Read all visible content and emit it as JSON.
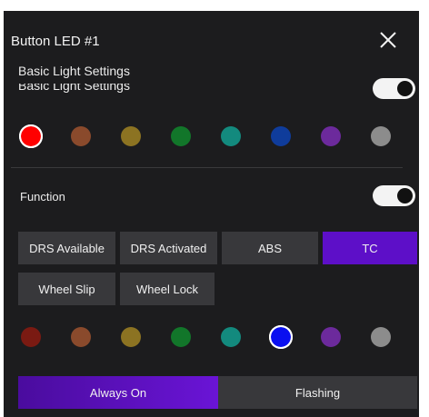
{
  "header": {
    "title": "Button LED #1"
  },
  "basic": {
    "section_label": "Basic Light Settings",
    "section_label_partial": "Basic Light Settings",
    "toggle_on": true,
    "colors": [
      "#ff0000",
      "#8a4a2c",
      "#8c7322",
      "#12762a",
      "#138a7e",
      "#0f3c9b",
      "#6c2a9c",
      "#8c8c8c"
    ],
    "selected_index": 0
  },
  "function": {
    "label": "Function",
    "toggle_on": true,
    "buttons": [
      {
        "label": "DRS Available",
        "active": false
      },
      {
        "label": "DRS Activated",
        "active": false
      },
      {
        "label": "ABS",
        "active": false
      },
      {
        "label": "TC",
        "active": true
      },
      {
        "label": "Wheel Slip",
        "active": false
      },
      {
        "label": "Wheel Lock",
        "active": false
      }
    ],
    "colors": [
      "#7a1a12",
      "#8a4a2c",
      "#8c7322",
      "#12762a",
      "#138a7e",
      "#0a0ff0",
      "#6c2a9c",
      "#8c8c8c"
    ],
    "selected_index": 5
  },
  "modes": {
    "always_on": "Always On",
    "flashing": "Flashing",
    "selected": "Always On"
  }
}
